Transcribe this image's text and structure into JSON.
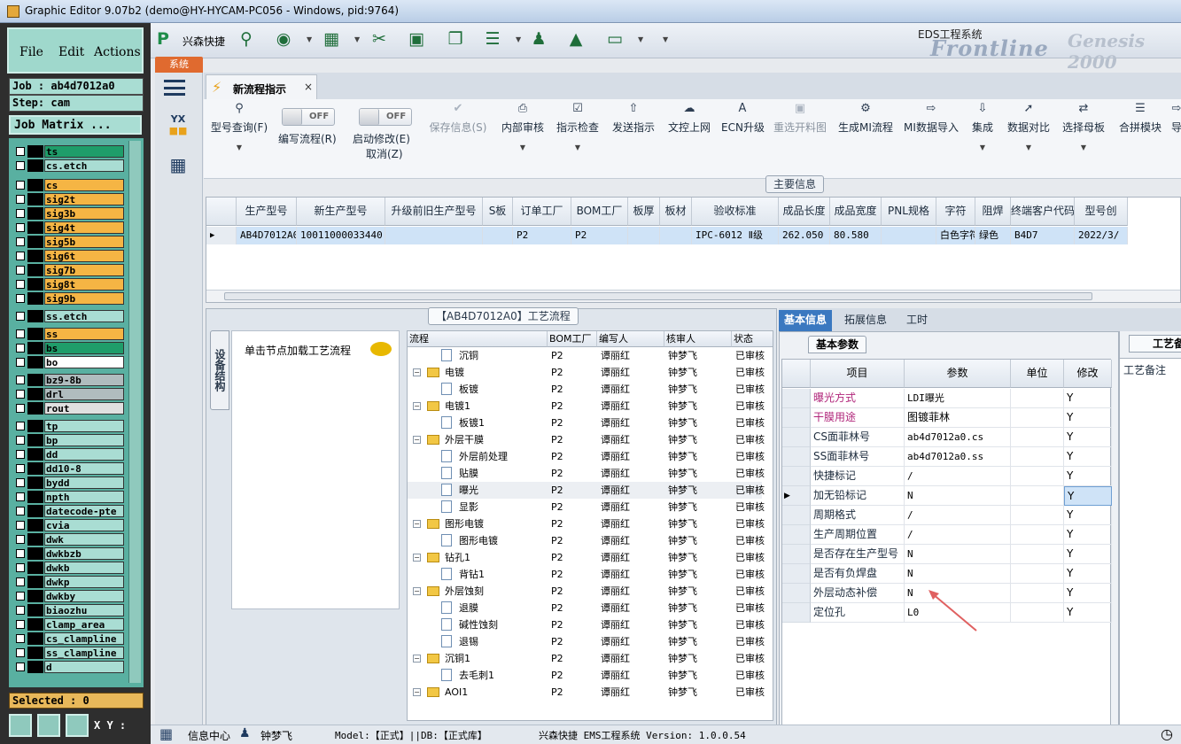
{
  "window": {
    "title": "Graphic Editor 9.07b2 (demo@HY-HYCAM-PC056 - Windows, pid:9764)"
  },
  "left": {
    "menu": [
      "File",
      "Edit",
      "Actions"
    ],
    "job": "Job : ab4d7012a0",
    "step": "Step: cam",
    "matrix": "Job Matrix ...",
    "layers": [
      {
        "name": "ts",
        "color": "#1f9d6a"
      },
      {
        "name": "cs.etch",
        "color": "#a9ddd3"
      },
      {
        "name": "cs",
        "color": "#f5b544"
      },
      {
        "name": "sig2t",
        "color": "#f5b544"
      },
      {
        "name": "sig3b",
        "color": "#f5b544"
      },
      {
        "name": "sig4t",
        "color": "#f5b544"
      },
      {
        "name": "sig5b",
        "color": "#f5b544"
      },
      {
        "name": "sig6t",
        "color": "#f5b544"
      },
      {
        "name": "sig7b",
        "color": "#f5b544"
      },
      {
        "name": "sig8t",
        "color": "#f5b544"
      },
      {
        "name": "sig9b",
        "color": "#f5b544"
      },
      {
        "name": "ss.etch",
        "color": "#a9ddd3"
      },
      {
        "name": "ss",
        "color": "#f5b544"
      },
      {
        "name": "bs",
        "color": "#1f9d6a"
      },
      {
        "name": "bo",
        "color": "#ffffff"
      },
      {
        "name": "bz9-8b",
        "color": "#b0bcbe"
      },
      {
        "name": "drl",
        "color": "#b0bcbe"
      },
      {
        "name": "rout",
        "color": "#e0e0e0"
      },
      {
        "name": "tp",
        "color": "#a9ddd3"
      },
      {
        "name": "bp",
        "color": "#a9ddd3"
      },
      {
        "name": "dd",
        "color": "#a9ddd3"
      },
      {
        "name": "dd10-8",
        "color": "#a9ddd3"
      },
      {
        "name": "bydd",
        "color": "#a9ddd3"
      },
      {
        "name": "npth",
        "color": "#a9ddd3"
      },
      {
        "name": "datecode-pte",
        "color": "#a9ddd3"
      },
      {
        "name": "cvia",
        "color": "#a9ddd3"
      },
      {
        "name": "dwk",
        "color": "#a9ddd3"
      },
      {
        "name": "dwkbzb",
        "color": "#a9ddd3"
      },
      {
        "name": "dwkb",
        "color": "#a9ddd3"
      },
      {
        "name": "dwkp",
        "color": "#a9ddd3"
      },
      {
        "name": "dwkby",
        "color": "#a9ddd3"
      },
      {
        "name": "biaozhu",
        "color": "#a9ddd3"
      },
      {
        "name": "clamp_area",
        "color": "#a9ddd3"
      },
      {
        "name": "cs_clampline",
        "color": "#a9ddd3"
      },
      {
        "name": "ss_clampline",
        "color": "#a9ddd3"
      },
      {
        "name": "d",
        "color": "#a9ddd3"
      }
    ],
    "selected": "Selected : 0",
    "xy": "X Y :"
  },
  "toolbar": {
    "brand": "兴森快捷",
    "eds_title": "EDS工程系统",
    "logo": "Frontline",
    "logo2": "Genesis 2000"
  },
  "sys_tab": "系统",
  "doc_tab": {
    "label": "新流程指示",
    "close": "×"
  },
  "ribbon": {
    "query": "型号查询(F)",
    "write_flow": "编写流程(R)",
    "start_modify": "启动修改(E)",
    "cancel": "取消(Z)",
    "toggle_off": "OFF",
    "save": "保存信息(S)",
    "internal_review": "内部审核",
    "guide_check": "指示检查",
    "send_guide": "发送指示",
    "upload": "文控上网",
    "ecn": "ECN升级",
    "reselect": "重选开料图",
    "gen_mi": "生成MI流程",
    "mi_import": "MI数据导入",
    "integrate": "集成",
    "compare": "数据对比",
    "select_mother": "选择母板",
    "merge": "合拼模块",
    "more": "导"
  },
  "main_info": {
    "title": "主要信息",
    "headers": [
      "生产型号",
      "新生产型号",
      "升级前旧生产型号",
      "S板",
      "订单工厂",
      "BOM工厂",
      "板厚",
      "板材",
      "验收标准",
      "成品长度",
      "成品宽度",
      "PNL规格",
      "字符",
      "阻焊",
      "终端客户代码",
      "型号创"
    ],
    "row": [
      "AB4D7012A0",
      "10011000033440",
      "",
      "",
      "P2",
      "P2",
      "",
      "",
      "IPC-6012 Ⅱ级",
      "262.050",
      "80.580",
      "",
      "白色字符",
      "绿色",
      "B4D7",
      "2022/3/"
    ]
  },
  "process": {
    "title": "【AB4D7012A0】工艺流程",
    "vtab": "设备结构",
    "hint": "单击节点加载工艺流程",
    "headers": [
      "流程",
      "BOM工厂",
      "编写人",
      "核审人",
      "状态"
    ],
    "rows": [
      {
        "name": "沉铜",
        "bom": "P2",
        "writer": "谭丽红",
        "reviewer": "钟梦飞",
        "status": "已审核",
        "type": "doc",
        "level": 2,
        "sel": false
      },
      {
        "name": "电镀",
        "bom": "P2",
        "writer": "谭丽红",
        "reviewer": "钟梦飞",
        "status": "已审核",
        "type": "folder",
        "level": 1,
        "sel": false
      },
      {
        "name": "板镀",
        "bom": "P2",
        "writer": "谭丽红",
        "reviewer": "钟梦飞",
        "status": "已审核",
        "type": "doc",
        "level": 2,
        "sel": false
      },
      {
        "name": "电镀1",
        "bom": "P2",
        "writer": "谭丽红",
        "reviewer": "钟梦飞",
        "status": "已审核",
        "type": "folder",
        "level": 1,
        "sel": false
      },
      {
        "name": "板镀1",
        "bom": "P2",
        "writer": "谭丽红",
        "reviewer": "钟梦飞",
        "status": "已审核",
        "type": "doc",
        "level": 2,
        "sel": false
      },
      {
        "name": "外层干膜",
        "bom": "P2",
        "writer": "谭丽红",
        "reviewer": "钟梦飞",
        "status": "已审核",
        "type": "folder",
        "level": 1,
        "sel": false
      },
      {
        "name": "外层前处理",
        "bom": "P2",
        "writer": "谭丽红",
        "reviewer": "钟梦飞",
        "status": "已审核",
        "type": "doc",
        "level": 2,
        "sel": false
      },
      {
        "name": "贴膜",
        "bom": "P2",
        "writer": "谭丽红",
        "reviewer": "钟梦飞",
        "status": "已审核",
        "type": "doc",
        "level": 2,
        "sel": false
      },
      {
        "name": "曝光",
        "bom": "P2",
        "writer": "谭丽红",
        "reviewer": "钟梦飞",
        "status": "已审核",
        "type": "doc",
        "level": 2,
        "sel": true
      },
      {
        "name": "显影",
        "bom": "P2",
        "writer": "谭丽红",
        "reviewer": "钟梦飞",
        "status": "已审核",
        "type": "doc",
        "level": 2,
        "sel": false
      },
      {
        "name": "图形电镀",
        "bom": "P2",
        "writer": "谭丽红",
        "reviewer": "钟梦飞",
        "status": "已审核",
        "type": "folder",
        "level": 1,
        "sel": false
      },
      {
        "name": "图形电镀",
        "bom": "P2",
        "writer": "谭丽红",
        "reviewer": "钟梦飞",
        "status": "已审核",
        "type": "doc",
        "level": 2,
        "sel": false
      },
      {
        "name": "钻孔1",
        "bom": "P2",
        "writer": "谭丽红",
        "reviewer": "钟梦飞",
        "status": "已审核",
        "type": "folder",
        "level": 1,
        "sel": false
      },
      {
        "name": "背钻1",
        "bom": "P2",
        "writer": "谭丽红",
        "reviewer": "钟梦飞",
        "status": "已审核",
        "type": "doc",
        "level": 2,
        "sel": false
      },
      {
        "name": "外层蚀刻",
        "bom": "P2",
        "writer": "谭丽红",
        "reviewer": "钟梦飞",
        "status": "已审核",
        "type": "folder",
        "level": 1,
        "sel": false
      },
      {
        "name": "退膜",
        "bom": "P2",
        "writer": "谭丽红",
        "reviewer": "钟梦飞",
        "status": "已审核",
        "type": "doc",
        "level": 2,
        "sel": false
      },
      {
        "name": "碱性蚀刻",
        "bom": "P2",
        "writer": "谭丽红",
        "reviewer": "钟梦飞",
        "status": "已审核",
        "type": "doc",
        "level": 2,
        "sel": false
      },
      {
        "name": "退锡",
        "bom": "P2",
        "writer": "谭丽红",
        "reviewer": "钟梦飞",
        "status": "已审核",
        "type": "doc",
        "level": 2,
        "sel": false
      },
      {
        "name": "沉铜1",
        "bom": "P2",
        "writer": "谭丽红",
        "reviewer": "钟梦飞",
        "status": "已审核",
        "type": "folder",
        "level": 1,
        "sel": false
      },
      {
        "name": "去毛刺1",
        "bom": "P2",
        "writer": "谭丽红",
        "reviewer": "钟梦飞",
        "status": "已审核",
        "type": "doc",
        "level": 2,
        "sel": false
      },
      {
        "name": "AOI1",
        "bom": "P2",
        "writer": "谭丽红",
        "reviewer": "钟梦飞",
        "status": "已审核",
        "type": "folder",
        "level": 1,
        "sel": false
      }
    ]
  },
  "right": {
    "tabs": [
      "基本信息",
      "拓展信息",
      "工时"
    ],
    "param_tab": "基本参数",
    "headers": [
      "项目",
      "参数",
      "单位",
      "修改"
    ],
    "rows": [
      {
        "item": "曝光方式",
        "param": "LDI曝光",
        "unit": "",
        "mod": "Y",
        "color": "#b0257a",
        "current": false
      },
      {
        "item": "干膜用途",
        "param": "图镀菲林",
        "unit": "",
        "mod": "Y",
        "color": "#b0257a",
        "current": false
      },
      {
        "item": "CS面菲林号",
        "param": "ab4d7012a0.cs",
        "unit": "",
        "mod": "Y",
        "color": "#1c2b3c",
        "current": false
      },
      {
        "item": "SS面菲林号",
        "param": "ab4d7012a0.ss",
        "unit": "",
        "mod": "Y",
        "color": "#1c2b3c",
        "current": false
      },
      {
        "item": "快捷标记",
        "param": "/",
        "unit": "",
        "mod": "Y",
        "color": "#1c2b3c",
        "current": false
      },
      {
        "item": "加无铅标记",
        "param": "N",
        "unit": "",
        "mod": "Y",
        "color": "#1c2b3c",
        "current": true
      },
      {
        "item": "周期格式",
        "param": "/",
        "unit": "",
        "mod": "Y",
        "color": "#1c2b3c",
        "current": false
      },
      {
        "item": "生产周期位置",
        "param": "/",
        "unit": "",
        "mod": "Y",
        "color": "#1c2b3c",
        "current": false
      },
      {
        "item": "是否存在生产型号",
        "param": "N",
        "unit": "",
        "mod": "Y",
        "color": "#1c2b3c",
        "current": false
      },
      {
        "item": "是否有负焊盘",
        "param": "N",
        "unit": "",
        "mod": "Y",
        "color": "#1c2b3c",
        "current": false
      },
      {
        "item": "外层动态补偿",
        "param": "N",
        "unit": "",
        "mod": "Y",
        "color": "#1c2b3c",
        "current": false
      },
      {
        "item": "定位孔",
        "param": "L0",
        "unit": "",
        "mod": "Y",
        "color": "#1c2b3c",
        "current": false
      }
    ],
    "remark_title": "工艺备",
    "remark_label": "工艺备注"
  },
  "status": {
    "info_center": "信息中心",
    "user": "钟梦飞",
    "model": "Model:【正式】||DB:【正式库】",
    "app": "兴森快捷 EMS工程系统 Version: 1.0.0.54"
  }
}
